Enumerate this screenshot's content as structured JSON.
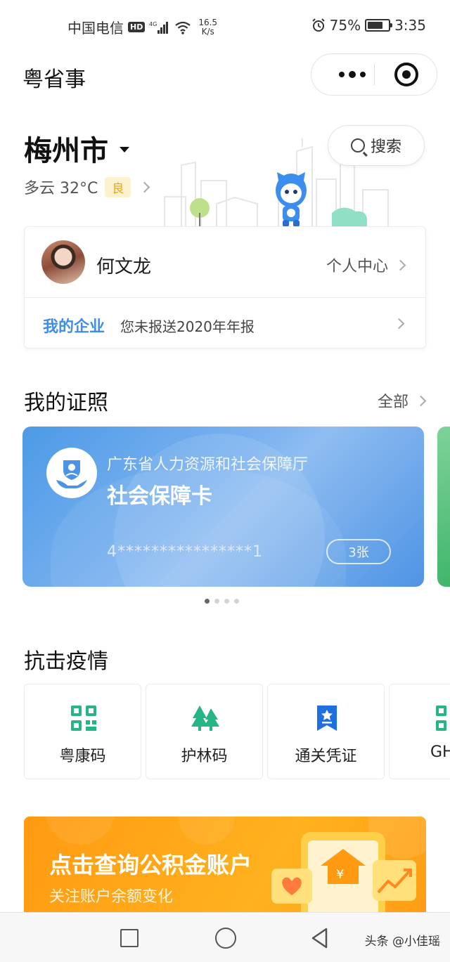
{
  "status_bar": {
    "carrier": "中国电信",
    "hd": "HD",
    "network": "4G",
    "speed_value": "16.5",
    "speed_unit": "K/s",
    "battery_percent": "75%",
    "battery_level": 0.75,
    "time": "3:35"
  },
  "app": {
    "title": "粤省事"
  },
  "location": {
    "city": "梅州市",
    "weather": "多云 32°C",
    "aqi": "良",
    "search_label": "搜索"
  },
  "user": {
    "name": "何文龙",
    "center_label": "个人中心",
    "enterprise_label": "我的企业",
    "enterprise_notice": "您未报送2020年年报"
  },
  "licenses": {
    "title": "我的证照",
    "all_label": "全部",
    "card": {
      "org": "广东省人力资源和社会保障厅",
      "name": "社会保障卡",
      "number": "4****************1",
      "count": "3张"
    },
    "page_count": 4,
    "active_page": 0
  },
  "epidemic": {
    "title": "抗击疫情",
    "tiles": [
      {
        "label": "粤康码",
        "icon": "qr-code-icon"
      },
      {
        "label": "护林码",
        "icon": "trees-icon"
      },
      {
        "label": "通关凭证",
        "icon": "pass-badge-icon"
      },
      {
        "label": "GH",
        "icon": "qr-code-icon"
      }
    ]
  },
  "banner": {
    "title": "点击查询公积金账户",
    "subtitle": "关注账户余额变化"
  },
  "watermark": "头条 @小佳瑶",
  "colors": {
    "accent_blue": "#3d8ee6",
    "green": "#26b585",
    "orange": "#ff9d15",
    "badge_blue": "#1f6fe0"
  }
}
